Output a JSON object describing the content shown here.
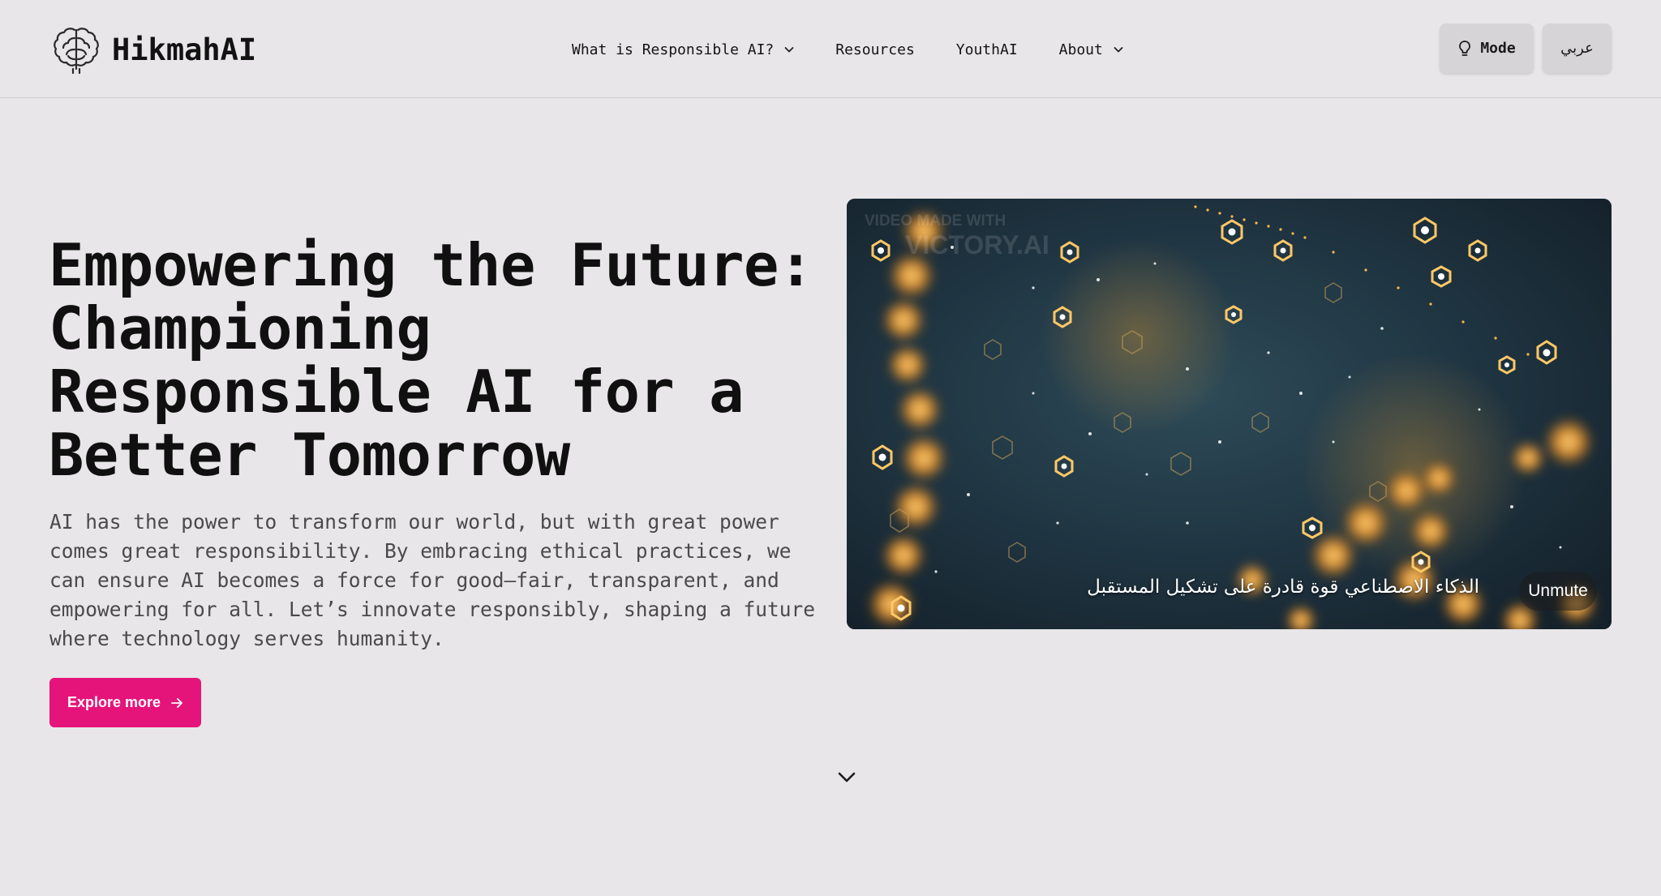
{
  "header": {
    "brand": "HikmahAI",
    "logo_icon": "brain-icon",
    "nav": [
      {
        "label": "What is Responsible AI?",
        "has_dropdown": true
      },
      {
        "label": "Resources",
        "has_dropdown": false
      },
      {
        "label": "YouthAI",
        "has_dropdown": false
      },
      {
        "label": "About",
        "has_dropdown": true
      }
    ],
    "mode_button": {
      "label": "Mode",
      "icon": "lightbulb-icon"
    },
    "language_button": {
      "label": "عربي"
    }
  },
  "hero": {
    "title": "Empowering the Future: Championing Responsible AI for a Better Tomorrow",
    "description": "AI has the power to transform our world, but with great power comes great responsibility. By embracing ethical practices, we can ensure AI becomes a force for good—fair, transparent, and empowering for all. Let’s innovate responsibly, shaping a future where technology serves humanity.",
    "cta": {
      "label": "Explore more",
      "icon": "arrow-right-icon"
    }
  },
  "video": {
    "watermark_line1": "VIDEO MADE WITH",
    "watermark_line2": "VICTORY.AI",
    "caption": "الذكاء الاصطناعي قوة قادرة على تشكيل المستقبل",
    "unmute_label": "Unmute"
  },
  "scroll_indicator": {
    "icon": "chevron-down-icon"
  },
  "colors": {
    "background": "#e8e6e8",
    "accent": "#e5147a",
    "button_gray": "#d6d4d6",
    "text_dark": "#111111",
    "text_muted": "#4a4a4a"
  }
}
